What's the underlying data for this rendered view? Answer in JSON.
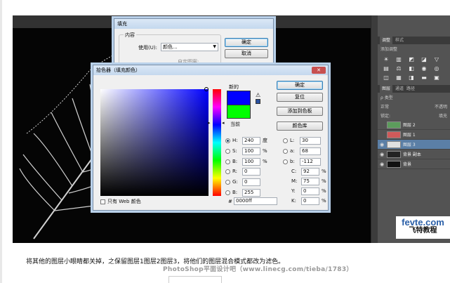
{
  "fill_dialog": {
    "title": "填充",
    "group_label": "内容",
    "use_label": "使用(U):",
    "use_value": "颜色...",
    "custom_label": "自定图案:",
    "ok_label": "确定",
    "cancel_label": "取消"
  },
  "picker": {
    "title": "拾色器（填充颜色）",
    "ok_label": "确定",
    "reset_label": "复位",
    "add_swatch_label": "添加到色板",
    "libraries_label": "颜色库",
    "new_label": "新的",
    "current_label": "当前",
    "new_color": "#0000ff",
    "current_color": "#00ff00",
    "web_only_label": "只有 Web 颜色",
    "hex_label": "#",
    "hex_value": "0000ff",
    "hsb": [
      {
        "label": "H:",
        "value": "240",
        "unit": "度",
        "selected": true
      },
      {
        "label": "S:",
        "value": "100",
        "unit": "%",
        "selected": false
      },
      {
        "label": "B:",
        "value": "100",
        "unit": "%",
        "selected": false
      }
    ],
    "rgb": [
      {
        "label": "R:",
        "value": "0"
      },
      {
        "label": "G:",
        "value": "0"
      },
      {
        "label": "B:",
        "value": "255"
      }
    ],
    "lab": [
      {
        "label": "L:",
        "value": "30"
      },
      {
        "label": "a:",
        "value": "68"
      },
      {
        "label": "b:",
        "value": "-112"
      }
    ],
    "cmyk": [
      {
        "label": "C:",
        "value": "92",
        "unit": "%"
      },
      {
        "label": "M:",
        "value": "75",
        "unit": "%"
      },
      {
        "label": "Y:",
        "value": "0",
        "unit": "%"
      },
      {
        "label": "K:",
        "value": "0",
        "unit": "%"
      }
    ]
  },
  "panels": {
    "adjust_tabs": [
      "调整",
      "样式"
    ],
    "adjust_hint": "添加调整",
    "layer_tabs": [
      "图层",
      "通道",
      "路径"
    ],
    "kind_label": "ρ 类型",
    "blend_mode": "正常",
    "opacity_hint": "不透明",
    "lock_label": "锁定:",
    "fill_hint": "填充",
    "layers": [
      {
        "name": "图层 2",
        "visible": false,
        "selected": false,
        "thumb": "#5c9c5c"
      },
      {
        "name": "图层 1",
        "visible": false,
        "selected": false,
        "thumb": "#d05a5a"
      },
      {
        "name": "图层 3",
        "visible": true,
        "selected": true,
        "thumb": "#e0e0e0"
      },
      {
        "name": "背景 副本",
        "visible": true,
        "selected": false,
        "thumb": "#222222"
      },
      {
        "name": "背景",
        "visible": true,
        "selected": false,
        "thumb": "#111111"
      }
    ]
  },
  "logo": {
    "line1": "fevte.com",
    "line2": "飞特教程"
  },
  "caption": "将其他的图层小眼睛都关掉，之保留图层1图层2图层3，将他们的图层混合模式都改为滤色。",
  "watermark": "PhotoShop平面设计吧（www.linecg.com/tieba/1783）"
}
